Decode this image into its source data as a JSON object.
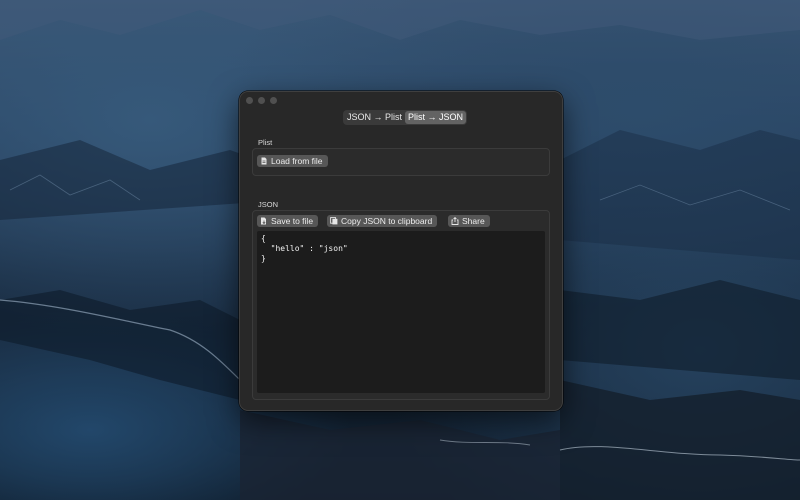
{
  "window": {
    "mode_tabs": [
      {
        "label": "JSON → Plist",
        "active": false
      },
      {
        "label": "Plist → JSON",
        "active": true
      }
    ]
  },
  "plist_section": {
    "label": "Plist",
    "load_button": "Load from file"
  },
  "json_section": {
    "label": "JSON",
    "save_button": "Save to file",
    "copy_button": "Copy JSON to clipboard",
    "share_button": "Share",
    "editor_lines": [
      "{",
      "  \"hello\" : \"json\"",
      "}"
    ]
  },
  "colors": {
    "window_bg": "#282828",
    "button_bg": "#575757",
    "editor_bg": "#1c1c1c",
    "active_tab": "#636363"
  }
}
